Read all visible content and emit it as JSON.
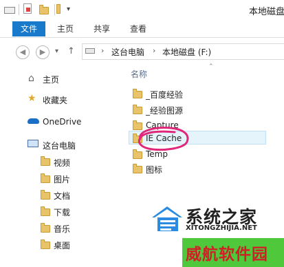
{
  "window": {
    "title": "本地磁盘"
  },
  "ribbon": {
    "tabs": [
      "文件",
      "主页",
      "共享",
      "查看"
    ]
  },
  "address": {
    "crumbs": [
      "这台电脑",
      "本地磁盘 (F:)"
    ]
  },
  "nav": {
    "items": [
      {
        "label": "主页",
        "icon": "home-icon"
      },
      {
        "label": "收藏夹",
        "icon": "star-icon"
      },
      {
        "label": "OneDrive",
        "icon": "cloud-icon"
      },
      {
        "label": "这台电脑",
        "icon": "computer-icon"
      },
      {
        "label": "视频",
        "icon": "folder-icon"
      },
      {
        "label": "图片",
        "icon": "folder-icon"
      },
      {
        "label": "文档",
        "icon": "folder-icon"
      },
      {
        "label": "下载",
        "icon": "folder-icon"
      },
      {
        "label": "音乐",
        "icon": "folder-icon"
      },
      {
        "label": "桌面",
        "icon": "folder-icon"
      }
    ]
  },
  "content": {
    "column_name": "名称",
    "files": [
      {
        "name": "_百度经验"
      },
      {
        "name": "_经验图源"
      },
      {
        "name": "Capture"
      },
      {
        "name": "IE Cache"
      },
      {
        "name": "Temp"
      },
      {
        "name": "图标"
      }
    ]
  },
  "watermark": {
    "site_cn": "系统之家",
    "site_url": "XITONGZHIJIA.NET",
    "brand_cn": "威航软件园"
  },
  "colors": {
    "accent": "#1979ca",
    "folder": "#e9c36a",
    "highlight_ring": "#e0277a",
    "banner_green": "#4fc83b",
    "banner_red": "#d11f28"
  }
}
